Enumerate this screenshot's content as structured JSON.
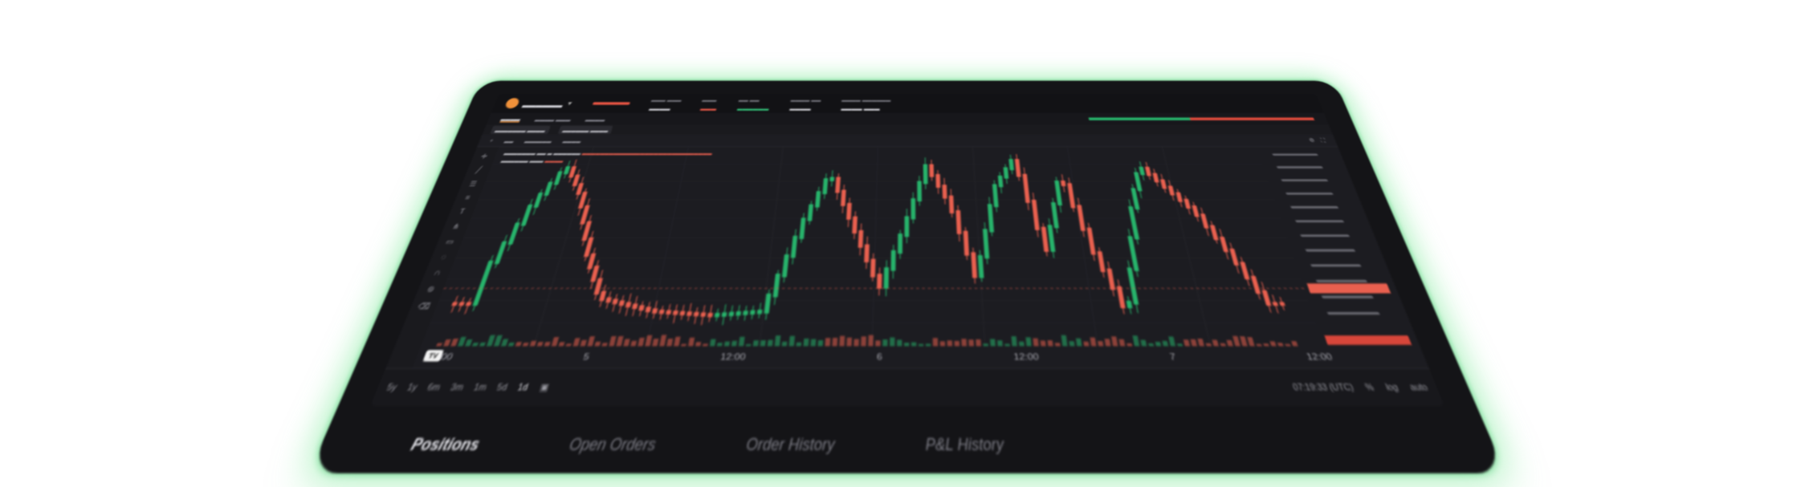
{
  "orders_tabs": [
    "Positions",
    "Open Orders",
    "Order History",
    "P&L History"
  ],
  "time_axis": [
    "12:00",
    "5",
    "12:00",
    "6",
    "12:00",
    "7",
    "12:00"
  ],
  "ranges": [
    "5y",
    "1y",
    "6m",
    "3m",
    "1m",
    "5d",
    "1d"
  ],
  "clock": "07:19:33 (UTC)",
  "scale_toggles": [
    "%",
    "log",
    "auto"
  ],
  "tv_logo": "TV",
  "colors": {
    "up": "#27b36b",
    "down": "#e9604f",
    "accent": "#f0913a",
    "glow": "#6ee68c"
  },
  "icons": {
    "coin": "bitcoin-icon",
    "chevron": "chevron-down-icon",
    "calendar": "calendar-icon"
  }
}
